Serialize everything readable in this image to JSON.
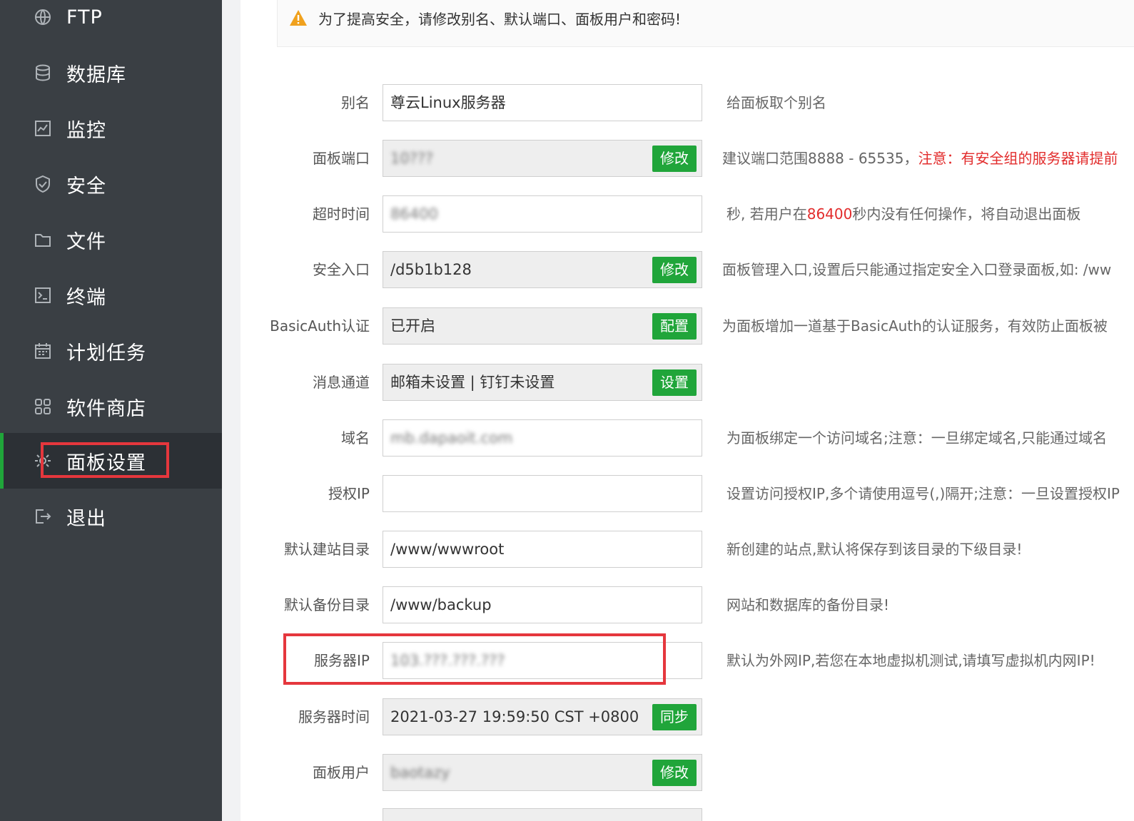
{
  "sidebar": {
    "items": [
      {
        "label": "FTP",
        "icon": "globe-icon"
      },
      {
        "label": "数据库",
        "icon": "database-icon"
      },
      {
        "label": "监控",
        "icon": "monitor-icon"
      },
      {
        "label": "安全",
        "icon": "shield-icon"
      },
      {
        "label": "文件",
        "icon": "folder-icon"
      },
      {
        "label": "终端",
        "icon": "terminal-icon"
      },
      {
        "label": "计划任务",
        "icon": "calendar-icon"
      },
      {
        "label": "软件商店",
        "icon": "apps-grid-icon"
      },
      {
        "label": "面板设置",
        "icon": "gear-icon"
      },
      {
        "label": "退出",
        "icon": "logout-icon"
      }
    ],
    "active_index": 8
  },
  "warning": {
    "text": "为了提高安全，请修改别名、默认端口、面板用户和密码!",
    "icon": "warning-triangle-icon"
  },
  "settings": {
    "alias": {
      "label": "别名",
      "value": "尊云Linux服务器",
      "hint": "给面板取个别名"
    },
    "port": {
      "label": "面板端口",
      "value": "10???",
      "button": "修改",
      "hint": "建议端口范围8888 - 65535，",
      "hint_warn": "注意：有安全组的服务器请提前"
    },
    "timeout": {
      "label": "超时时间",
      "value": "86400",
      "hint_prefix": "秒, 若用户在",
      "hint_value": "86400",
      "hint_suffix": "秒内没有任何操作，将自动退出面板"
    },
    "entry": {
      "label": "安全入口",
      "value": "/d5b1b128",
      "button": "修改",
      "hint": "面板管理入口,设置后只能通过指定安全入口登录面板,如: /ww"
    },
    "basicauth": {
      "label": "BasicAuth认证",
      "value": "已开启",
      "button": "配置",
      "hint": "为面板增加一道基于BasicAuth的认证服务，有效防止面板被"
    },
    "message": {
      "label": "消息通道",
      "value": "邮箱未设置 | 钉钉未设置",
      "button": "设置"
    },
    "domain": {
      "label": "域名",
      "value": "mb.dapaoit.com",
      "hint": "为面板绑定一个访问域名;注意：一旦绑定域名,只能通过域名"
    },
    "auth_ip": {
      "label": "授权IP",
      "value": "",
      "hint": "设置访问授权IP,多个请使用逗号(,)隔开;注意：一旦设置授权IP"
    },
    "site_dir": {
      "label": "默认建站目录",
      "value": "/www/wwwroot",
      "hint": "新创建的站点,默认将保存到该目录的下级目录!"
    },
    "backup_dir": {
      "label": "默认备份目录",
      "value": "/www/backup",
      "hint": "网站和数据库的备份目录!"
    },
    "server_ip": {
      "label": "服务器IP",
      "value": "103.???.???.???",
      "hint": "默认为外网IP,若您在本地虚拟机测试,请填写虚拟机内网IP!"
    },
    "server_time": {
      "label": "服务器时间",
      "value": "2021-03-27 19:59:50 CST +0800",
      "button": "同步"
    },
    "panel_user": {
      "label": "面板用户",
      "value": "baotazy",
      "button": "修改"
    }
  },
  "colors": {
    "sidebar_bg": "#3a3f44",
    "sidebar_active_bg": "#2c3035",
    "accent_green": "#20a53a",
    "highlight_red": "#e5373d",
    "warning_red": "#e22c2c"
  }
}
